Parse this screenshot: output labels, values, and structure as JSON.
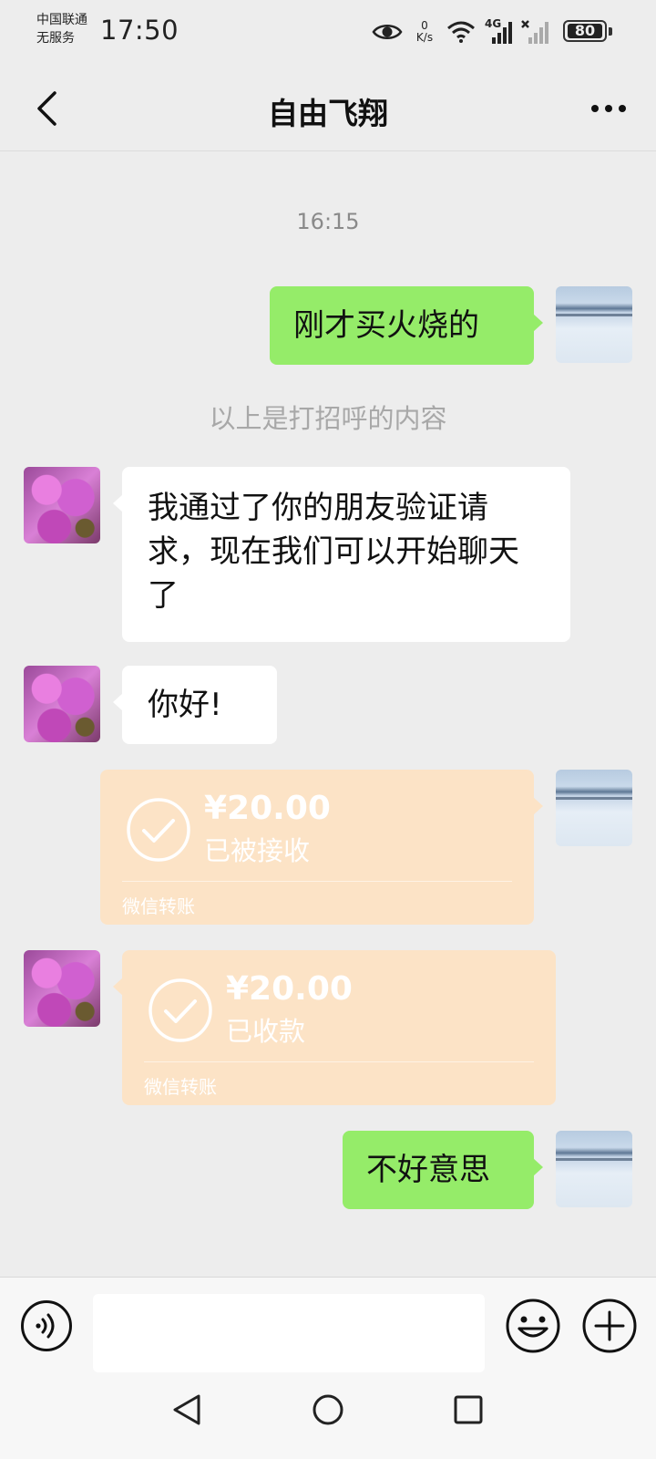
{
  "status_bar": {
    "carrier_line1": "中国联通",
    "carrier_line2": "无服务",
    "time": "17:50",
    "speed_value": "0",
    "speed_unit": "K/s",
    "network": "4G",
    "battery": "80"
  },
  "header": {
    "title": "自由飞翔",
    "back_icon": "chevron-left-icon",
    "more_icon": "more-dots-icon"
  },
  "messages": {
    "timestamp": "16:15",
    "msg1": "刚才买火烧的",
    "system_note": "以上是打招呼的内容",
    "msg2": "我通过了你的朋友验证请求，现在我们可以开始聊天了",
    "msg3": "你好!",
    "transfer1": {
      "amount": "¥20.00",
      "status": "已被接收",
      "label": "微信转账"
    },
    "transfer2": {
      "amount": "¥20.00",
      "status": "已收款",
      "label": "微信转账"
    },
    "msg4": "不好意思"
  },
  "input_bar": {
    "voice_icon": "voice-icon",
    "emoji_icon": "emoji-icon",
    "plus_icon": "plus-icon",
    "text_value": ""
  },
  "colors": {
    "background": "#ededed",
    "sent_bubble": "#95ec69",
    "received_bubble": "#ffffff",
    "transfer_bubble": "#fce3c6"
  }
}
